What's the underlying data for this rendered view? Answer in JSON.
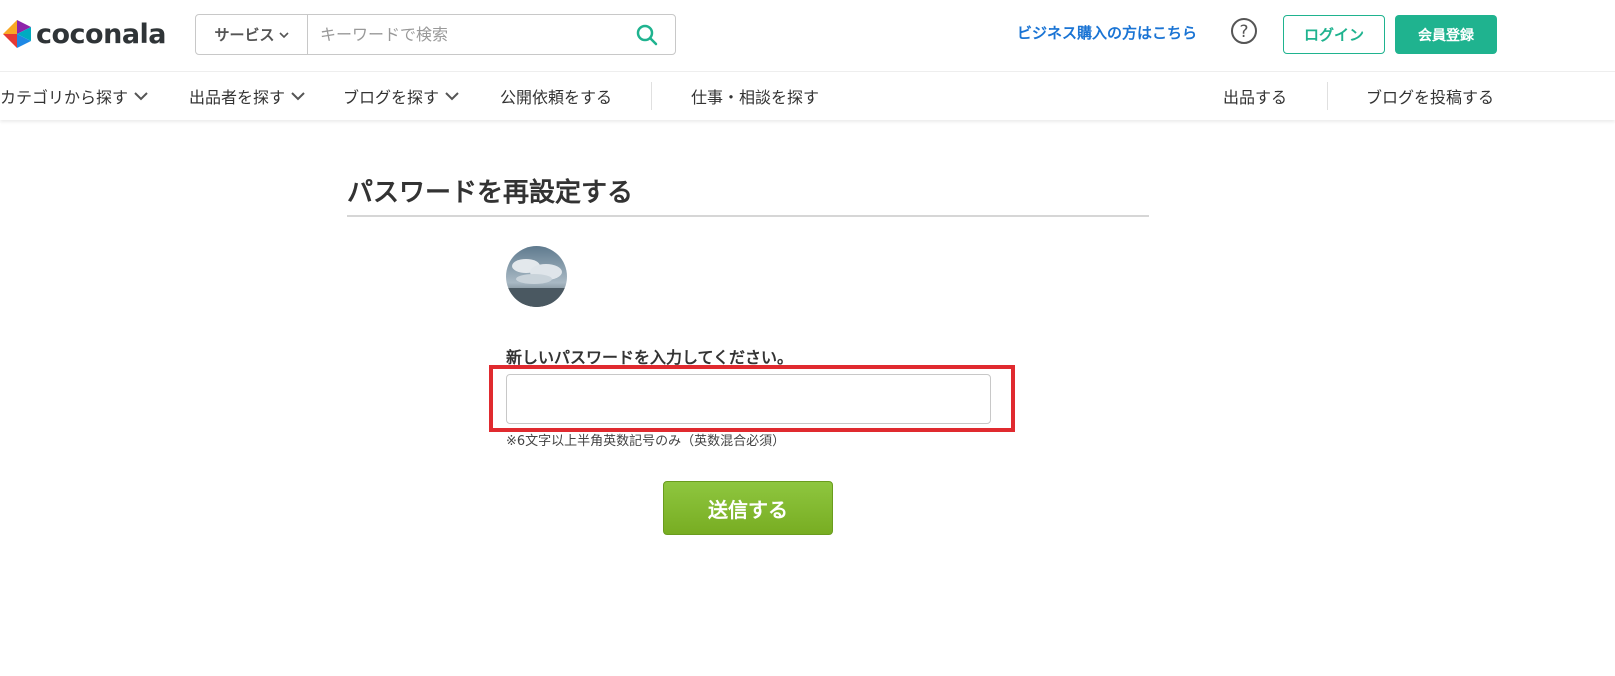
{
  "brand": {
    "name": "coconala"
  },
  "search": {
    "category_label": "サービス",
    "placeholder": "キーワードで検索"
  },
  "header": {
    "business_link": "ビジネス購入の方はこちら",
    "login_label": "ログイン",
    "register_label": "会員登録"
  },
  "nav": {
    "items": [
      {
        "label": "カテゴリから探す"
      },
      {
        "label": "出品者を探す"
      },
      {
        "label": "ブログを探す"
      },
      {
        "label": "公開依頼をする"
      },
      {
        "label": "仕事・相談を探す"
      },
      {
        "label": "出品する"
      },
      {
        "label": "ブログを投稿する"
      }
    ]
  },
  "form": {
    "title": "パスワードを再設定する",
    "password_label": "新しいパスワードを入力してください。",
    "password_value": "",
    "hint": "※6文字以上半角英数記号のみ（英数混合必須）",
    "submit_label": "送信する"
  },
  "colors": {
    "brand_green": "#1fb38f",
    "link_blue": "#1a74d4",
    "submit_green": "#8ec63f",
    "highlight_red": "#e02a2f"
  }
}
